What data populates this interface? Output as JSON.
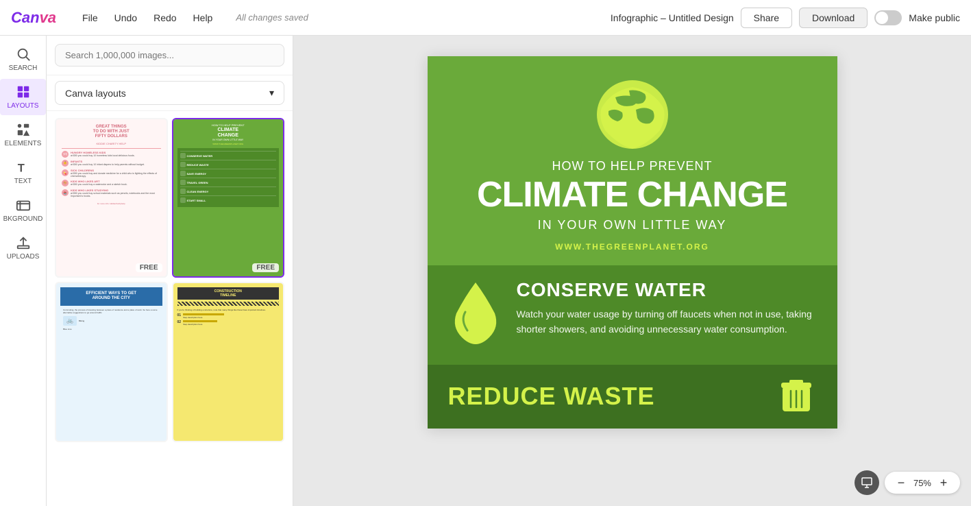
{
  "app": {
    "logo": "Canva",
    "menu": [
      "File",
      "Undo",
      "Redo",
      "Help"
    ],
    "autosave": "All changes saved",
    "design_title": "Infographic – Untitled Design",
    "share_label": "Share",
    "download_label": "Download",
    "make_public_label": "Make public"
  },
  "sidebar": {
    "items": [
      {
        "id": "search",
        "label": "SEARCH"
      },
      {
        "id": "layouts",
        "label": "LAYOUTS"
      },
      {
        "id": "elements",
        "label": "ELEMENTS"
      },
      {
        "id": "text",
        "label": "TEXT"
      },
      {
        "id": "background",
        "label": "BKGROUND"
      },
      {
        "id": "uploads",
        "label": "UPLOADS"
      }
    ]
  },
  "panel": {
    "search_placeholder": "Search 1,000,000 images...",
    "dropdown_label": "Canva layouts",
    "layout_cards": [
      {
        "id": "charity",
        "type": "charity",
        "badge": "FREE"
      },
      {
        "id": "climate",
        "type": "climate",
        "badge": "FREE",
        "selected": true
      },
      {
        "id": "city",
        "type": "city",
        "badge": ""
      },
      {
        "id": "construction",
        "type": "construction",
        "badge": ""
      }
    ]
  },
  "infographic": {
    "top_text": "HOW TO HELP PREVENT",
    "main_title": "CLIMATE CHANGE",
    "subtitle": "IN YOUR OWN LITTLE WAY",
    "url": "WWW.THEGREENPLANET.ORG",
    "sections": [
      {
        "id": "conserve",
        "title": "CONSERVE WATER",
        "body": "Watch your water usage by turning off faucets when not in use, taking shorter showers, and avoiding unnecessary water consumption."
      },
      {
        "id": "reduce",
        "title": "REDUCE WASTE",
        "body": ""
      }
    ]
  },
  "zoom": {
    "level": "75%",
    "minus_label": "−",
    "plus_label": "+"
  }
}
